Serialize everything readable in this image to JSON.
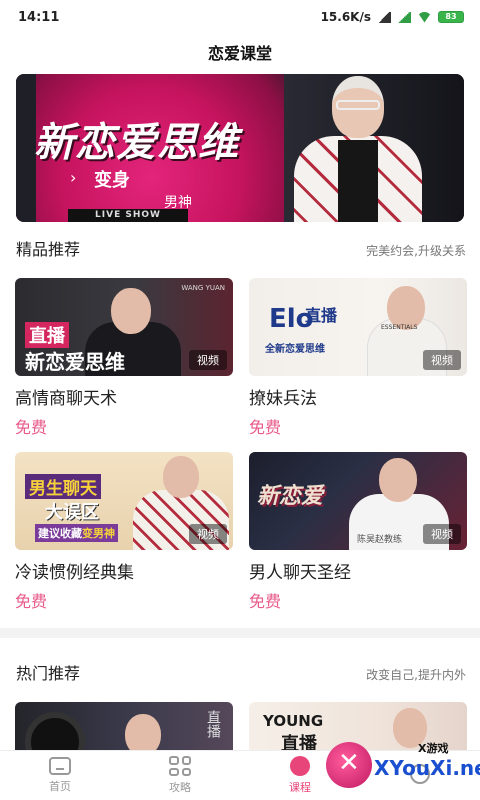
{
  "status": {
    "time": "14:11",
    "speed": "15.6K/s",
    "battery": "83"
  },
  "header": {
    "title": "恋爱课堂"
  },
  "banner": {
    "headline": "新恋爱思维",
    "sub": "变身",
    "sub2": "男神",
    "live": "LIVE SHOW"
  },
  "section1": {
    "title": "精品推荐",
    "subtitle": "完美约会,升级关系",
    "cards": [
      {
        "title": "高情商聊天术",
        "price": "免费",
        "tag": "视频",
        "overlay1": "直播",
        "overlay2": "新恋爱思维",
        "overlay3": "WANG YUAN"
      },
      {
        "title": "撩妹兵法",
        "price": "免费",
        "tag": "视频",
        "overlay1": "直播",
        "overlay2": "全新恋爱思维",
        "overlay3": "ESSENTIALS",
        "overlay4": "Elo"
      },
      {
        "title": "冷读惯例经典集",
        "price": "免费",
        "tag": "视频",
        "overlay1": "男生聊天",
        "overlay2": "大误区",
        "overlay3": "建议收藏",
        "overlay4": "变男神"
      },
      {
        "title": "男人聊天圣经",
        "price": "免费",
        "tag": "视频",
        "overlay1": "新恋爱",
        "overlay2": "陈昊赵教练"
      }
    ]
  },
  "section2": {
    "title": "热门推荐",
    "subtitle": "改变自己,提升内外",
    "cards": [
      {
        "overlay1": "直播"
      },
      {
        "overlay1": "YOUNG",
        "overlay2": "直播"
      }
    ]
  },
  "tabbar": {
    "tabs": [
      {
        "label": "首页",
        "icon": "home-icon"
      },
      {
        "label": "攻略",
        "icon": "grid-icon"
      },
      {
        "label": "课程",
        "icon": "course-icon"
      },
      {
        "label": "",
        "icon": "profile-icon"
      }
    ],
    "active_color": "#e8457a"
  },
  "watermark": {
    "small": "X游戏",
    "big": "XYouXi.net"
  },
  "colors": {
    "accent": "#e85a8a",
    "banner_magenta": "#c7145f"
  }
}
